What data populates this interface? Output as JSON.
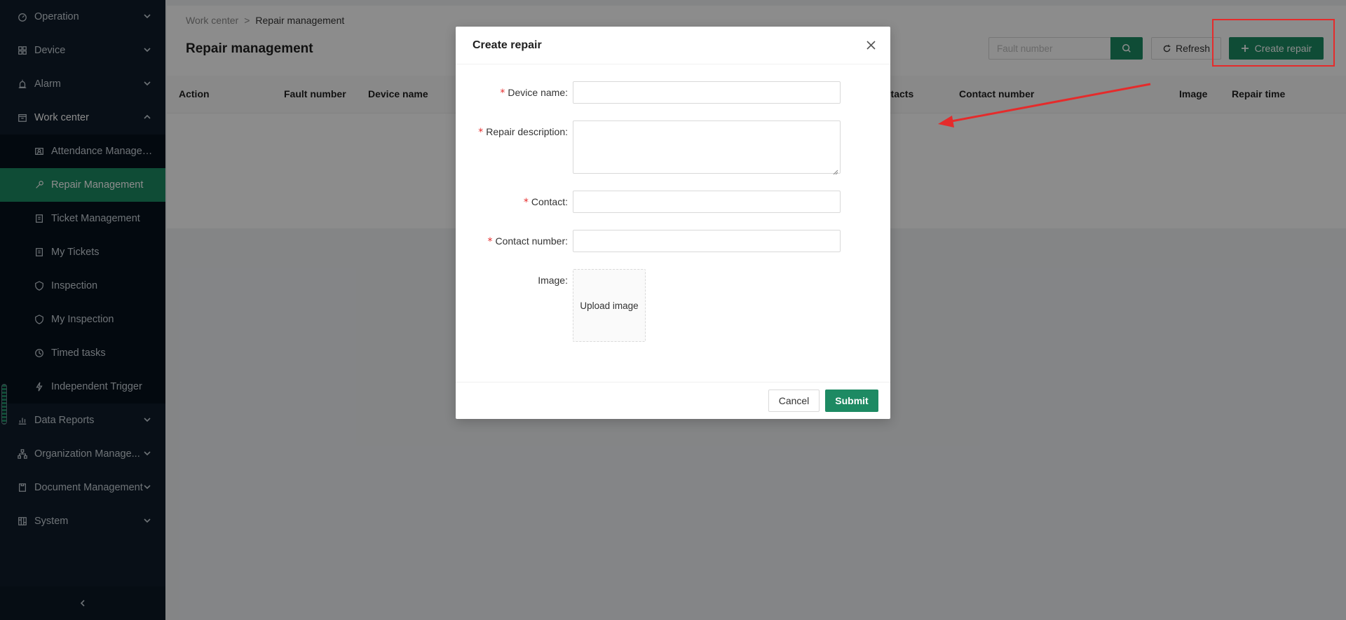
{
  "sidebar": {
    "items": [
      {
        "label": "Operation",
        "icon": "dashboard-icon"
      },
      {
        "label": "Device",
        "icon": "grid-icon"
      },
      {
        "label": "Alarm",
        "icon": "alarm-icon"
      },
      {
        "label": "Work center",
        "icon": "calendar-icon"
      }
    ],
    "work_center_sub": [
      {
        "label": "Attendance Managem...",
        "icon": "attendance-icon"
      },
      {
        "label": "Repair Management",
        "icon": "wrench-icon"
      },
      {
        "label": "Ticket Management",
        "icon": "ticket-icon"
      },
      {
        "label": "My Tickets",
        "icon": "ticket-icon"
      },
      {
        "label": "Inspection",
        "icon": "shield-icon"
      },
      {
        "label": "My Inspection",
        "icon": "shield-icon"
      },
      {
        "label": "Timed tasks",
        "icon": "clock-icon"
      },
      {
        "label": "Independent Trigger",
        "icon": "lightning-icon"
      }
    ],
    "items_after": [
      {
        "label": "Data Reports",
        "icon": "bar-chart-icon"
      },
      {
        "label": "Organization Manage...",
        "icon": "org-icon"
      },
      {
        "label": "Document Management",
        "icon": "document-icon"
      },
      {
        "label": "System",
        "icon": "settings-icon"
      }
    ],
    "accent_color": "#1d8a63"
  },
  "breadcrumb": {
    "parent": "Work center",
    "separator": ">",
    "current": "Repair management"
  },
  "page_title": "Repair management",
  "toolbar": {
    "search_placeholder": "Fault number",
    "refresh_label": "Refresh",
    "create_label": "Create repair"
  },
  "table": {
    "columns": [
      "Action",
      "Fault number",
      "Device name",
      "ntacts",
      "Contact number",
      "Image",
      "Repair time"
    ]
  },
  "modal": {
    "title": "Create repair",
    "fields": {
      "device_name": "Device name",
      "repair_description": "Repair description",
      "contact": "Contact",
      "contact_number": "Contact number",
      "image": "Image"
    },
    "colon": ":",
    "upload_label": "Upload image",
    "cancel_label": "Cancel",
    "submit_label": "Submit"
  },
  "annotation": {
    "color": "#e52b2b"
  }
}
